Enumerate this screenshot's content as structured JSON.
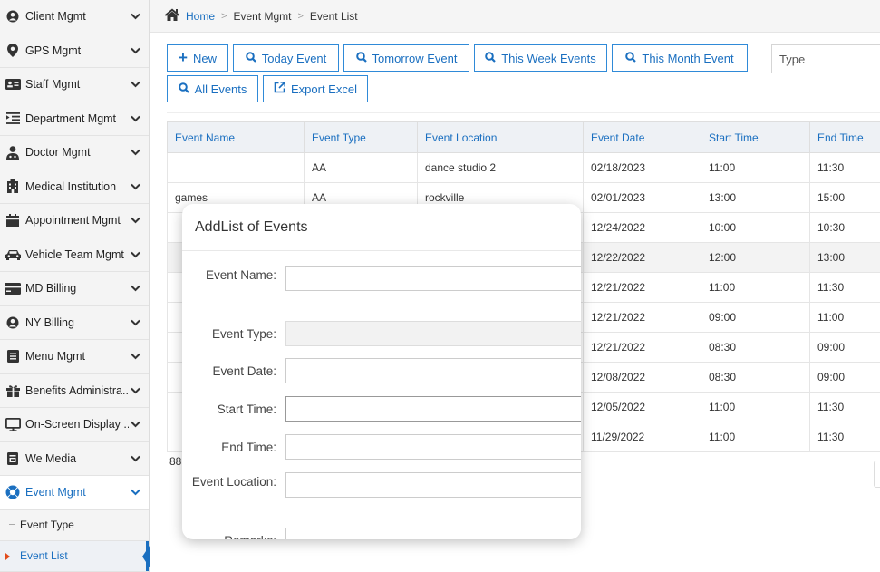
{
  "sidebar": {
    "items": [
      {
        "label": "Client Mgmt",
        "icon": "user-icon"
      },
      {
        "label": "GPS Mgmt",
        "icon": "map-pin-icon"
      },
      {
        "label": "Staff Mgmt",
        "icon": "id-card-icon"
      },
      {
        "label": "Department Mgmt",
        "icon": "indent-icon"
      },
      {
        "label": "Doctor Mgmt",
        "icon": "doctor-icon"
      },
      {
        "label": "Medical Institution",
        "icon": "building-icon"
      },
      {
        "label": "Appointment Mgmt",
        "icon": "calendar-icon"
      },
      {
        "label": "Vehicle Team Mgmt",
        "icon": "car-icon"
      },
      {
        "label": "MD Billing",
        "icon": "credit-card-icon"
      },
      {
        "label": "NY Billing",
        "icon": "user-icon"
      },
      {
        "label": "Menu Mgmt",
        "icon": "list-icon"
      },
      {
        "label": "Benefits Administra..",
        "icon": "gift-icon"
      },
      {
        "label": "On-Screen Display ...",
        "icon": "monitor-icon"
      },
      {
        "label": "We Media",
        "icon": "media-icon"
      },
      {
        "label": "Event Mgmt",
        "icon": "lifebuoy-icon"
      }
    ],
    "sub_items": [
      {
        "label": "Event Type"
      },
      {
        "label": "Event List"
      }
    ],
    "accent": "#1a6fc0"
  },
  "breadcrumb": {
    "home": "Home",
    "section": "Event Mgmt",
    "page": "Event List"
  },
  "toolbar": {
    "new_label": "New",
    "today_label": "Today Event",
    "tomorrow_label": "Tomorrow Event",
    "week_label": "This Week Events",
    "month_label": "This Month Event",
    "all_label": "All Events",
    "export_label": "Export Excel",
    "type_placeholder": "Type"
  },
  "table": {
    "headers": [
      "Event Name",
      "Event Type",
      "Event Location",
      "Event Date",
      "Start Time",
      "End Time"
    ],
    "rows": [
      [
        "",
        "AA",
        "dance studio 2",
        "02/18/2023",
        "11:00",
        "11:30"
      ],
      [
        "games",
        "AA",
        "rockville",
        "02/01/2023",
        "13:00",
        "15:00"
      ],
      [
        "",
        "",
        "",
        "12/24/2022",
        "10:00",
        "10:30"
      ],
      [
        "",
        "",
        "",
        "12/22/2022",
        "12:00",
        "13:00"
      ],
      [
        "",
        "",
        "",
        "12/21/2022",
        "11:00",
        "11:30"
      ],
      [
        "",
        "",
        "",
        "12/21/2022",
        "09:00",
        "11:00"
      ],
      [
        "",
        "",
        "",
        "12/21/2022",
        "08:30",
        "09:00"
      ],
      [
        "",
        "",
        "",
        "12/08/2022",
        "08:30",
        "09:00"
      ],
      [
        "",
        "",
        "",
        "12/05/2022",
        "11:00",
        "11:30"
      ],
      [
        "",
        "",
        "",
        "11/29/2022",
        "11:00",
        "11:30"
      ]
    ],
    "count_text": "88"
  },
  "modal": {
    "title": "AddList of Events",
    "fields": [
      {
        "label": "Event Name:",
        "value": ""
      },
      {
        "label": "Event Type:",
        "value": ""
      },
      {
        "label": "Event Date:",
        "value": ""
      },
      {
        "label": "Start Time:",
        "value": ""
      },
      {
        "label": "End Time:",
        "value": ""
      },
      {
        "label": "Event Location:",
        "value": ""
      },
      {
        "label": "Remarks:",
        "value": ""
      }
    ]
  }
}
